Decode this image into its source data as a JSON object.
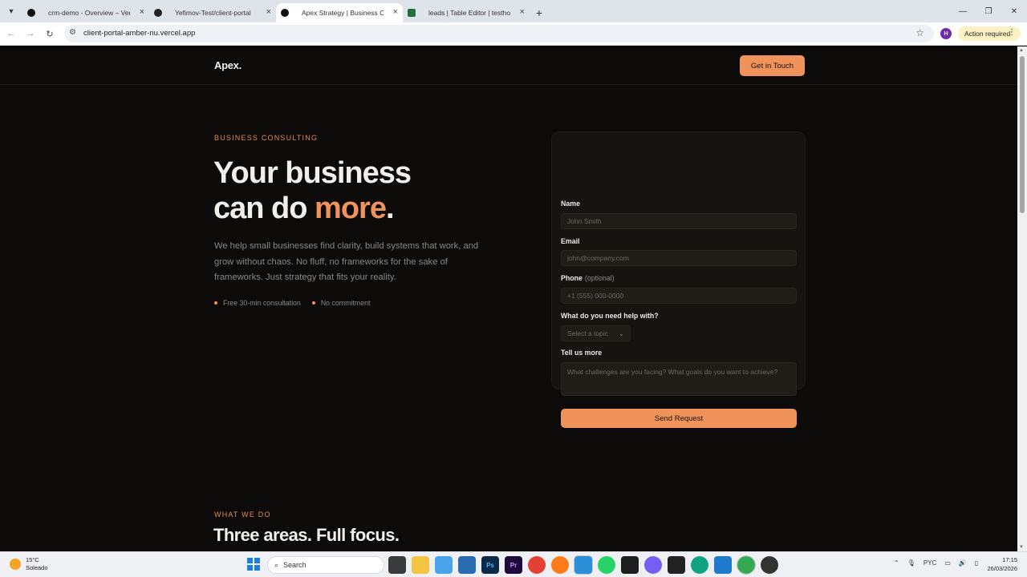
{
  "browser": {
    "tabs": [
      {
        "title": "crm-demo - Overview – Vercel",
        "icon": "vercel-icon"
      },
      {
        "title": "Yefimov-Test/client-portal",
        "icon": "github-icon"
      },
      {
        "title": "Apex Strategy | Business Consu",
        "icon": "vercel-icon",
        "active": true
      },
      {
        "title": "leads | Table Editor | testhooks",
        "icon": "supabase-icon"
      }
    ],
    "url": "client-portal-amber-nu.vercel.app",
    "profile_initial": "H",
    "action_required": "Action required"
  },
  "site": {
    "logo": "Apex.",
    "cta": "Get in Touch"
  },
  "hero": {
    "eyebrow": "BUSINESS CONSULTING",
    "headline_line1": "Your business",
    "headline_line2_a": "can do ",
    "headline_accent": "more",
    "headline_period": ".",
    "lead": "We help small businesses find clarity, build systems that work, and grow without chaos. No fluff, no frameworks for the sake of frameworks. Just strategy that fits your reality.",
    "bullets": [
      "Free 30-min consultation",
      "No commitment"
    ]
  },
  "form": {
    "name_label": "Name",
    "name_placeholder": "John Smith",
    "email_label": "Email",
    "email_placeholder": "john@company.com",
    "phone_label": "Phone",
    "phone_optional": "(optional)",
    "phone_placeholder": "+1 (555) 000-0000",
    "topic_label": "What do you need help with?",
    "topic_selected": "Select a topic",
    "message_label": "Tell us more",
    "message_placeholder": "What challenges are you facing? What goals do you want to achieve?",
    "submit": "Send Request"
  },
  "section": {
    "eyebrow": "WHAT WE DO",
    "title": "Three areas. Full focus."
  },
  "taskbar": {
    "weather_temp": "15°C",
    "weather_desc": "Soleado",
    "search": "Search",
    "lang": "PYC",
    "time": "17:15",
    "date": "26/03/2026"
  },
  "colors": {
    "accent": "#f0935a",
    "background": "#0d0b09",
    "card": "#161310"
  }
}
